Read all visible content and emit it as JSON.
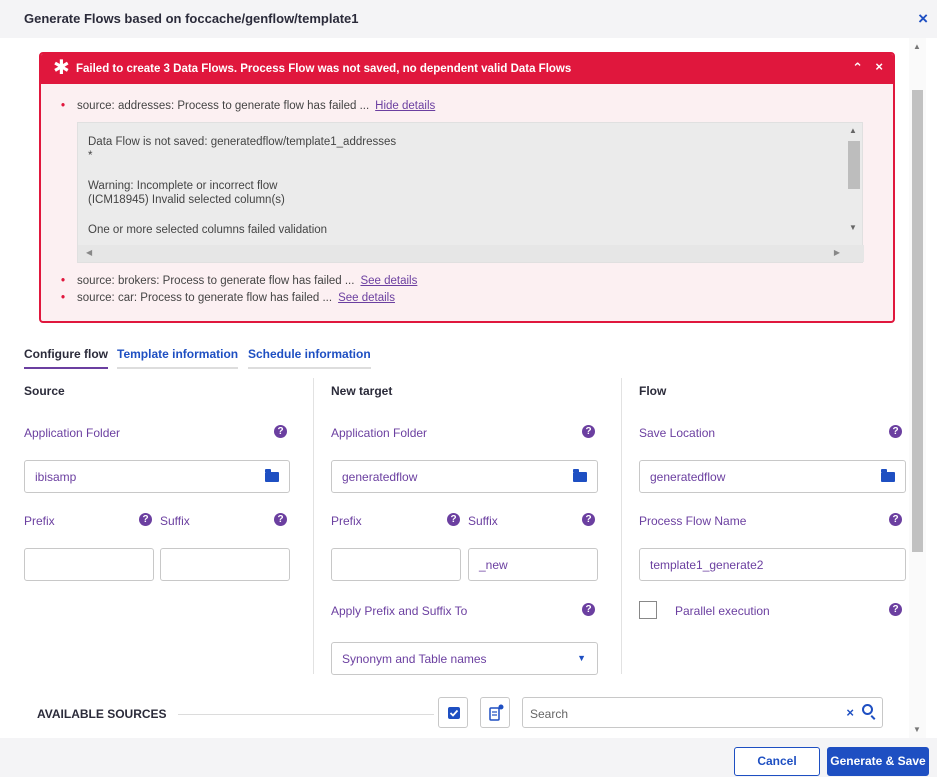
{
  "dialog": {
    "title": "Generate Flows based on foccache/genflow/template1",
    "close_icon": "×"
  },
  "alert": {
    "icon": "✱",
    "message": "Failed to create 3 Data Flows. Process Flow was not saved, no dependent valid Data Flows",
    "collapse_icon": "⌃",
    "close_icon": "×",
    "items": [
      {
        "bullet": "•",
        "text": "source: addresses: Process to generate flow has failed ...",
        "link": "Hide details"
      },
      {
        "bullet": "•",
        "text": "source: brokers: Process to generate flow has failed ...",
        "link": "See details"
      },
      {
        "bullet": "•",
        "text": "source: car: Process to generate flow has failed ...",
        "link": "See details"
      }
    ],
    "details": {
      "line1": "Data Flow is not saved: generatedflow/template1_addresses",
      "line2": "*",
      "line3": "Warning: Incomplete or incorrect flow",
      "line4": "(ICM18945) Invalid selected column(s)",
      "line5": "One or more selected columns failed validation"
    }
  },
  "tabs": [
    {
      "label": "Configure flow",
      "active": true
    },
    {
      "label": "Template information",
      "active": false
    },
    {
      "label": "Schedule information",
      "active": false
    }
  ],
  "source": {
    "title": "Source",
    "folder_label": "Application Folder",
    "folder_value": "ibisamp",
    "prefix_label": "Prefix",
    "suffix_label": "Suffix",
    "prefix_value": "",
    "suffix_value": ""
  },
  "target": {
    "title": "New target",
    "folder_label": "Application Folder",
    "folder_value": "generatedflow",
    "prefix_label": "Prefix",
    "suffix_label": "Suffix",
    "prefix_value": "",
    "suffix_value": "_new",
    "apply_label": "Apply Prefix and Suffix To",
    "apply_value": "Synonym and Table names"
  },
  "flow": {
    "title": "Flow",
    "save_label": "Save Location",
    "save_value": "generatedflow",
    "name_label": "Process Flow Name",
    "name_value": "template1_generate2",
    "parallel_label": "Parallel execution",
    "parallel_checked": false
  },
  "available": {
    "title": "AVAILABLE SOURCES",
    "search_placeholder": "Search",
    "search_clear": "×"
  },
  "footer": {
    "cancel_label": "Cancel",
    "save_label": "Generate & Save"
  },
  "colors": {
    "accent": "#1e4fc2",
    "purple": "#6b3fa0",
    "error": "#e0173d"
  }
}
